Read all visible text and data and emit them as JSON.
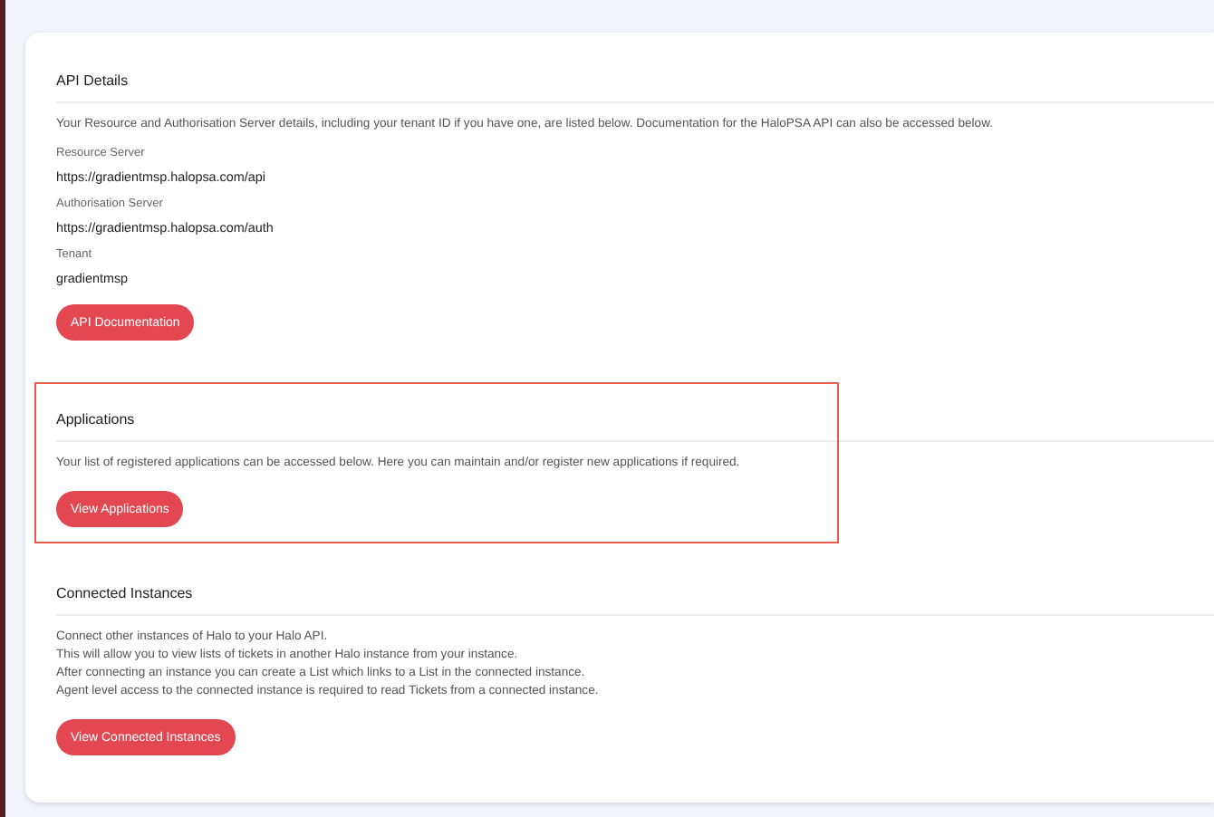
{
  "sections": [
    {
      "title": "API Details",
      "highlighted": false,
      "description": [
        "Your Resource and Authorisation Server details, including your tenant ID if you have one, are listed below. Documentation for the HaloPSA API can also be accessed below."
      ],
      "fields": [
        {
          "label": "Resource Server",
          "value": "https://gradientmsp.halopsa.com/api"
        },
        {
          "label": "Authorisation Server",
          "value": "https://gradientmsp.halopsa.com/auth"
        },
        {
          "label": "Tenant",
          "value": "gradientmsp"
        }
      ],
      "button": "API Documentation"
    },
    {
      "title": "Applications",
      "highlighted": true,
      "description": [
        "Your list of registered applications can be accessed below. Here you can maintain and/or register new applications if required."
      ],
      "button": "View Applications"
    },
    {
      "title": "Connected Instances",
      "highlighted": false,
      "description": [
        "Connect other instances of Halo to your Halo API.",
        "This will allow you to view lists of tickets in another Halo instance from your instance.",
        "After connecting an instance you can create a List which links to a List in the connected instance.",
        "Agent level access to the connected instance is required to read Tickets from a connected instance."
      ],
      "button": "View Connected Instances"
    }
  ]
}
